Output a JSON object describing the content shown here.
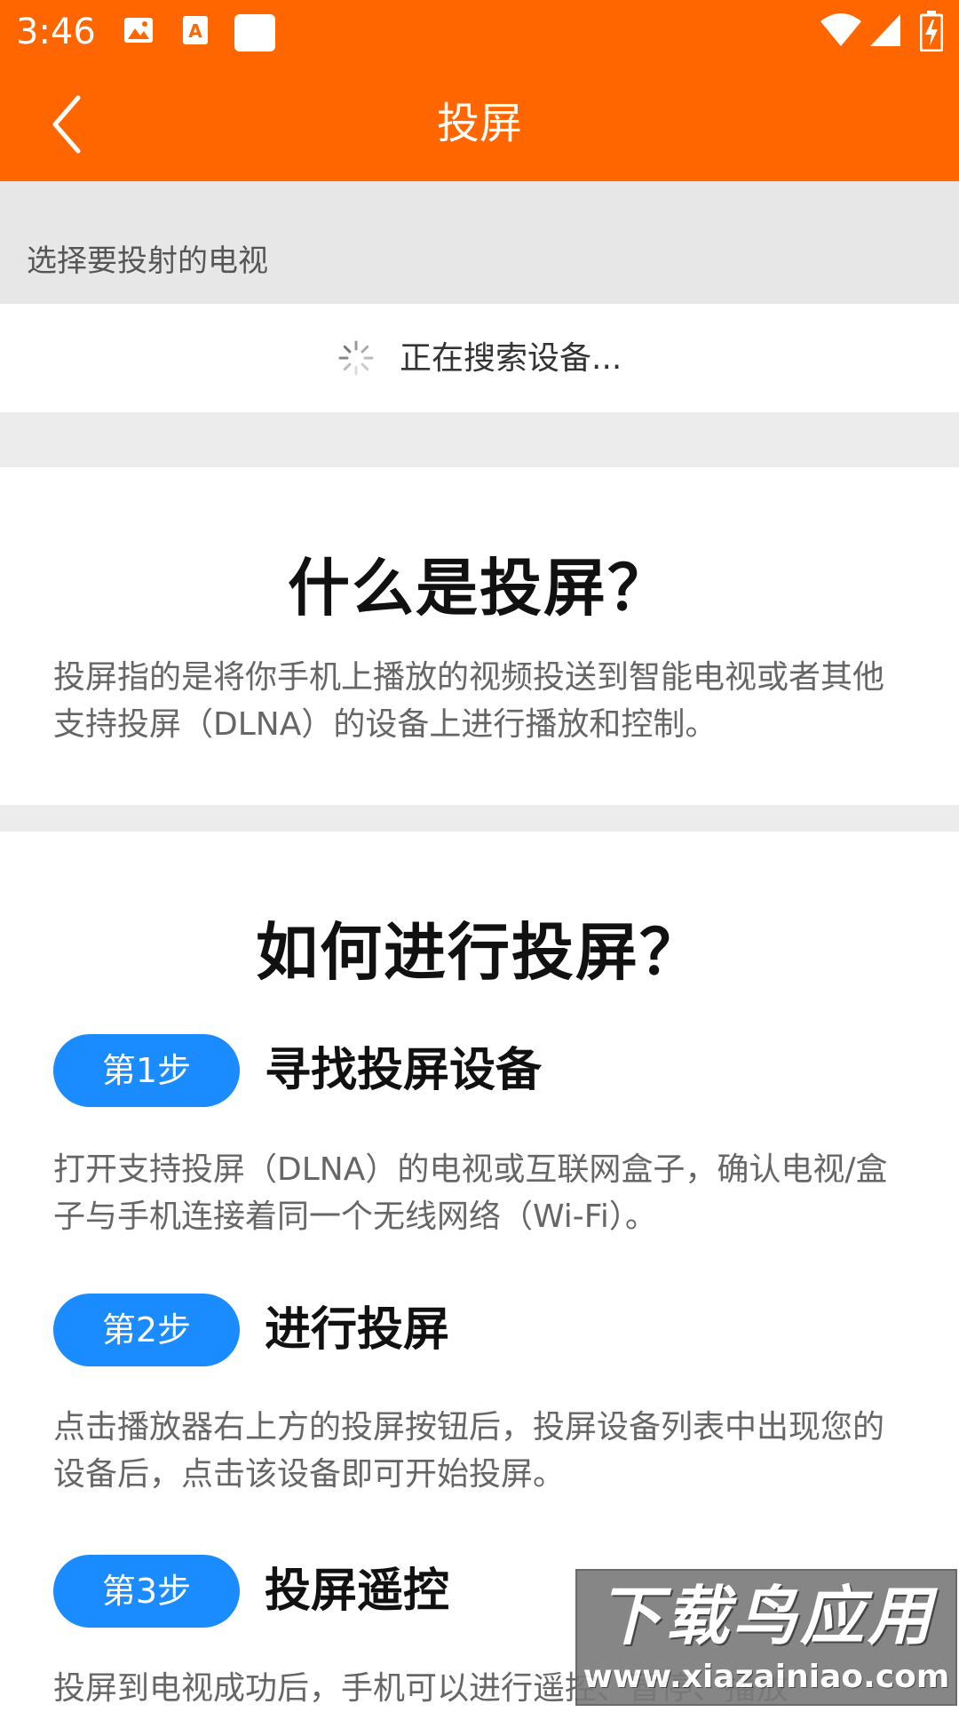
{
  "status_bar": {
    "time": "3:46",
    "icons": [
      "image-icon",
      "text-icon",
      "square-icon",
      "wifi-icon",
      "signal-icon",
      "battery-icon"
    ]
  },
  "app_bar": {
    "title": "投屏",
    "back_icon": "chevron-left-icon"
  },
  "device_section": {
    "header": "选择要投射的电视",
    "searching_text": "正在搜索设备..."
  },
  "what_is": {
    "title": "什么是投屏？",
    "description": "投屏指的是将你手机上播放的视频投送到智能电视或者其他支持投屏（DLNA）的设备上进行播放和控制。"
  },
  "how_to": {
    "title": "如何进行投屏？",
    "steps": [
      {
        "badge": "第1步",
        "title": "寻找投屏设备",
        "description": "打开支持投屏（DLNA）的电视或互联网盒子，确认电视/盒子与手机连接着同一个无线网络（Wi-Fi）。"
      },
      {
        "badge": "第2步",
        "title": "进行投屏",
        "description": "点击播放器右上方的投屏按钮后，投屏设备列表中出现您的设备后，点击该设备即可开始投屏。"
      },
      {
        "badge": "第3步",
        "title": "投屏遥控",
        "description": "投屏到电视成功后，手机可以进行遥控、暂停、播放"
      }
    ]
  },
  "watermark": {
    "cn": "下载鸟应用",
    "url": "www.xiazainiao.com"
  },
  "colors": {
    "accent": "#ff6600",
    "step_badge": "#1a8cff",
    "section_bg": "#e7e7e7"
  }
}
